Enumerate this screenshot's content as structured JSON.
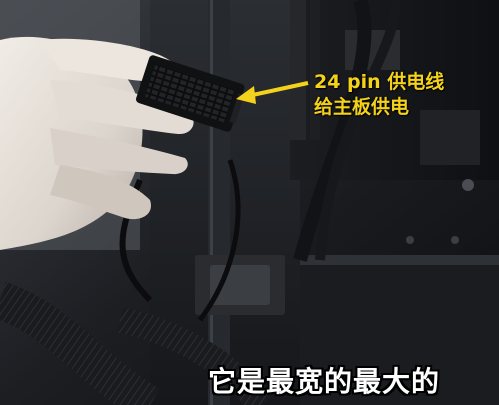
{
  "annotation": {
    "line1": "24 pin 供电线",
    "line2": "给主板供电",
    "color": "#f4d21c"
  },
  "subtitle": {
    "text": "它是最宽的最大的",
    "color": "#ffffff"
  },
  "scene": {
    "subject": "hand holding 24-pin power connector inside PC case",
    "icons": [
      "arrow-icon"
    ]
  }
}
